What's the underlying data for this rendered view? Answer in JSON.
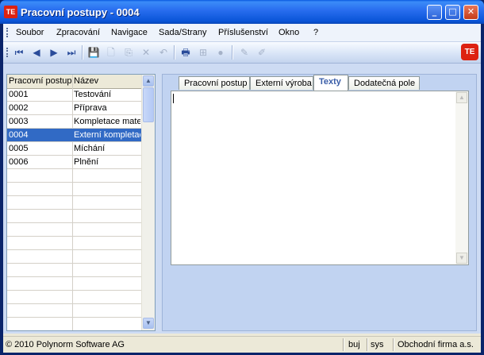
{
  "window": {
    "title": "Pracovní postupy - 0004",
    "logo_text": "TE",
    "min_glyph": "_",
    "max_glyph": "□",
    "close_glyph": "✕"
  },
  "menu": [
    "Soubor",
    "Zpracování",
    "Navigace",
    "Sada/Strany",
    "Příslušenství",
    "Okno",
    "?"
  ],
  "toolbar": {
    "first_icon": "⏮",
    "prev_icon": "◀",
    "next_icon": "▶",
    "last_icon": "⏭",
    "save_icon": "💾",
    "new_icon": "🗋",
    "copy_icon": "⎘",
    "delete_icon": "✕",
    "undo_icon": "↶",
    "print_icon": "🖶",
    "tree_icon": "⊞",
    "disc_icon": "●",
    "edit_icon": "✎",
    "erase_icon": "✐",
    "brand_text": "TE"
  },
  "grid": {
    "columns": [
      "Pracovní postup",
      "Název"
    ],
    "rows": [
      {
        "code": "0001",
        "name": "Testování"
      },
      {
        "code": "0002",
        "name": "Příprava"
      },
      {
        "code": "0003",
        "name": "Kompletace mate"
      },
      {
        "code": "0004",
        "name": "Externí kompletac"
      },
      {
        "code": "0005",
        "name": "Míchání"
      },
      {
        "code": "0006",
        "name": "Plnění"
      }
    ],
    "selected_index": 3
  },
  "tabs": [
    "Pracovní postup",
    "Externí výroba",
    "Texty",
    "Dodatečná pole"
  ],
  "active_tab": 2,
  "status": {
    "copyright": "© 2010 Polynorm Software AG",
    "user": "buj",
    "system": "sys",
    "company": "Obchodní firma a.s."
  },
  "colors": {
    "selection": "#316ac5",
    "titlebar": "#0a55d8",
    "content": "#cddbf3"
  }
}
